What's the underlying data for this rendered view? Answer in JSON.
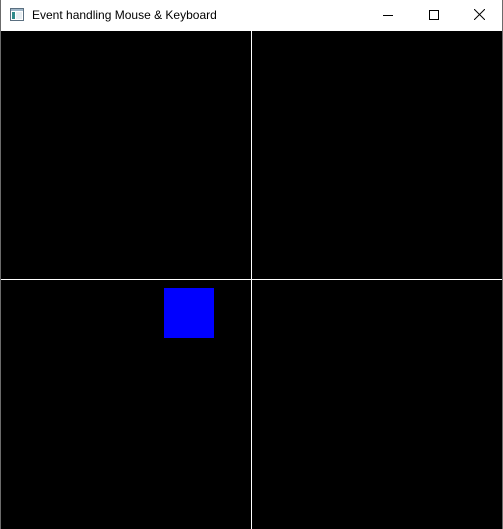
{
  "window": {
    "title": "Event handling Mouse & Keyboard",
    "app_icon": "app-window-icon",
    "controls": {
      "minimize_icon": "minimize-icon",
      "maximize_icon": "maximize-icon",
      "close_icon": "close-icon"
    }
  },
  "canvas": {
    "background_color": "#000000",
    "divider_color": "#ffffff",
    "square_color": "#0000ff"
  }
}
